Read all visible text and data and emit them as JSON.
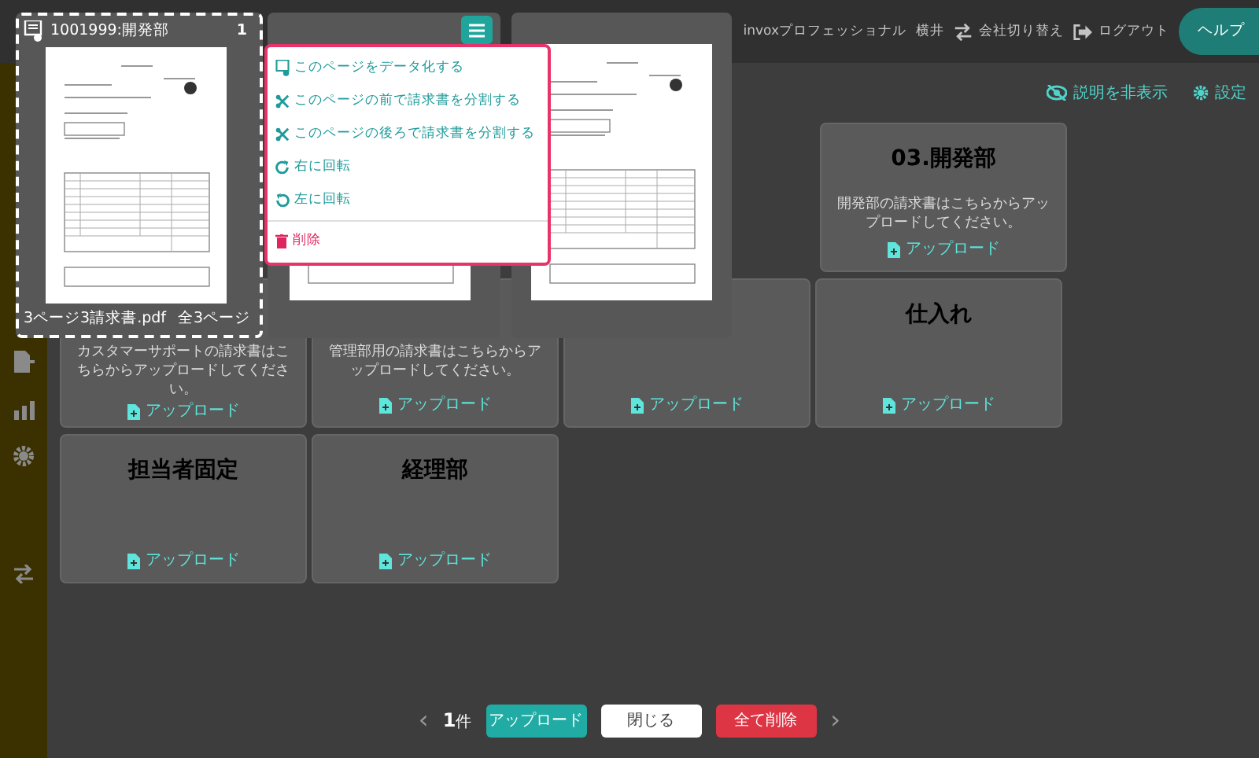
{
  "header": {
    "company": "invoxプロフェッショナル",
    "user": "横井",
    "switch_company": "会社切り替え",
    "logout": "ログアウト",
    "help": "ヘルプ"
  },
  "toolbar": {
    "hide_description": "説明を非表示",
    "settings": "設定"
  },
  "card_rows": [
    {
      "cards": [
        {
          "title": "03.開発部",
          "description": "開発部の請求書はこちらからアップロードしてください。",
          "upload": "アップロード"
        }
      ]
    },
    {
      "cards": [
        {
          "description": "カスタマーサポートの請求書はこちらからアップロードしてください。",
          "upload": "アップロード"
        },
        {
          "description": "管理部用の請求書はこちらからアップロードしてください。",
          "upload": "アップロード"
        },
        {
          "upload": "アップロード"
        },
        {
          "title": "仕入れ",
          "upload": "アップロード"
        }
      ]
    },
    {
      "cards": [
        {
          "title": "担当者固定",
          "upload": "アップロード"
        },
        {
          "title": "経理部",
          "upload": "アップロード"
        }
      ]
    }
  ],
  "pages": [
    {
      "label": "1001999:開発部",
      "number": "1",
      "filename": "3ページ3請求書.pdf",
      "page_count": "全3ページ",
      "selected": true,
      "menu_open": false
    },
    {
      "selected": false,
      "menu_open": true
    },
    {
      "selected": false,
      "menu_open": false
    }
  ],
  "page_menu": [
    {
      "kind": "digitize",
      "label": "このページをデータ化する"
    },
    {
      "kind": "split",
      "label": "このページの前で請求書を分割する"
    },
    {
      "kind": "split",
      "label": "このページの後ろで請求書を分割する"
    },
    {
      "kind": "rotate-right",
      "label": "右に回転"
    },
    {
      "kind": "rotate-left",
      "label": "左に回転"
    },
    {
      "kind": "delete",
      "label": "削除"
    }
  ],
  "footer": {
    "prev": "‹",
    "count": "1",
    "count_unit": "件",
    "upload": "アップロード",
    "close": "閉じる",
    "delete_all": "全て削除",
    "next": "›"
  }
}
